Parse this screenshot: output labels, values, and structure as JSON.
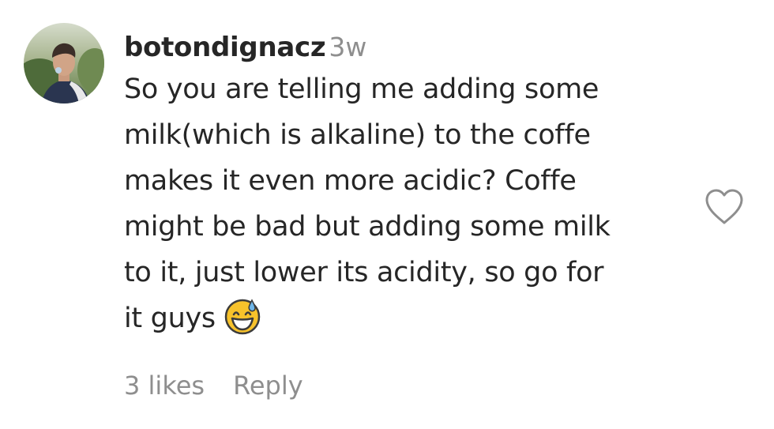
{
  "comment": {
    "username": "botondignacz",
    "time": "3w",
    "lines": [
      "So you are telling me adding some",
      "milk(which is alkaline) to the coffe",
      "makes it even more acidic? Coffe",
      "might be bad but adding some milk",
      "to it, just lower its acidity, so go for",
      "it guys"
    ],
    "emoji": "grinning-face-with-sweat",
    "likes": "3 likes",
    "reply_label": "Reply",
    "like_icon": "heart-outline-icon"
  },
  "colors": {
    "text": "#262626",
    "secondary": "#8e8e8e",
    "background": "#ffffff"
  }
}
